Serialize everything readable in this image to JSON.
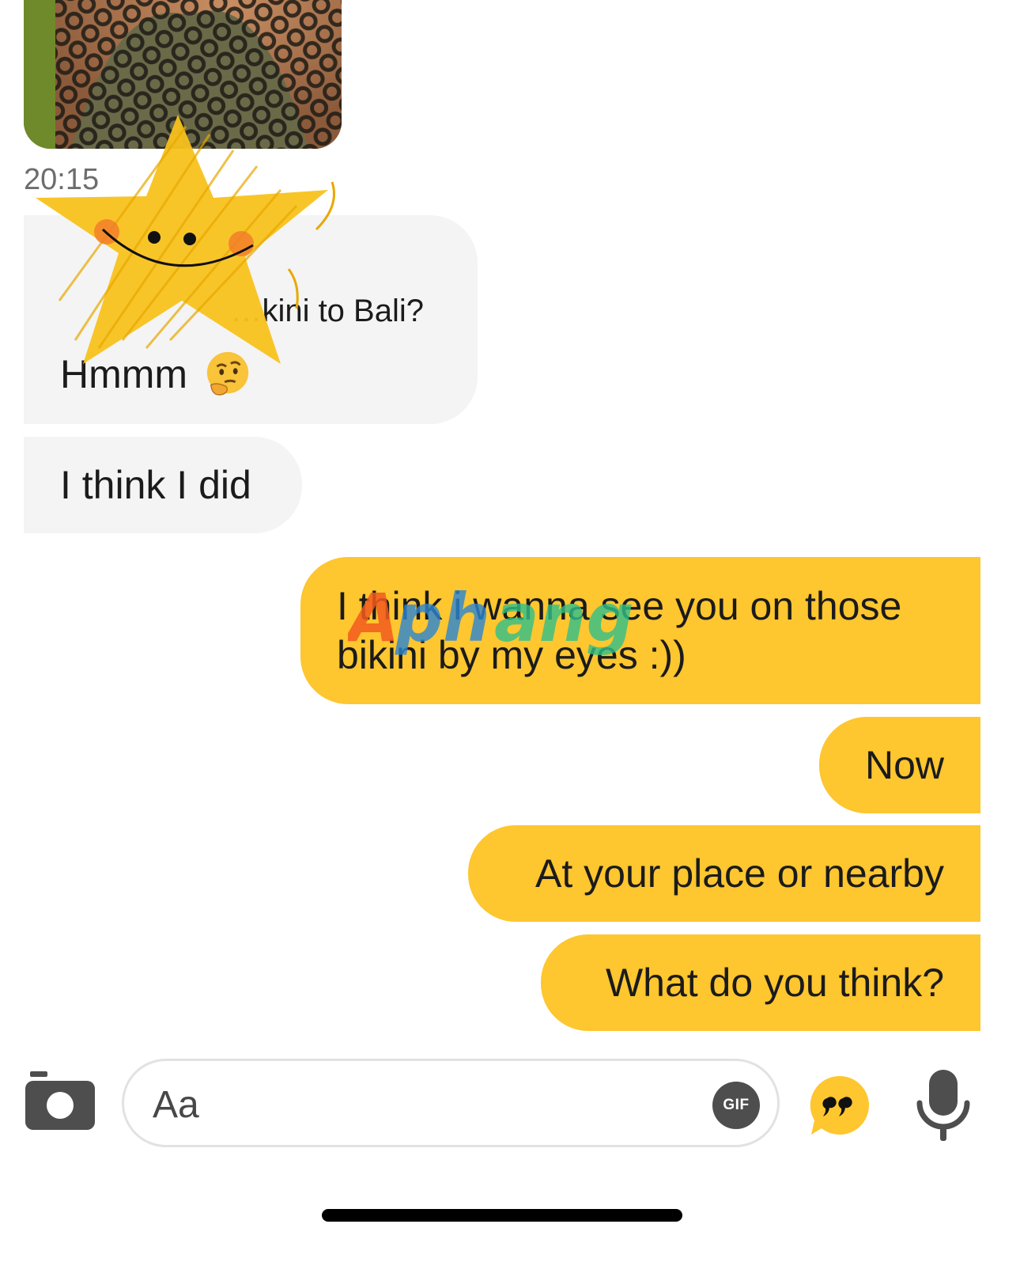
{
  "chat": {
    "timestamp": "20:15",
    "messages": [
      {
        "side": "incoming",
        "quote": "…kini to Bali?",
        "text": "Hmmm",
        "emoji": "thinking-face"
      },
      {
        "side": "incoming",
        "text": "I think I did"
      },
      {
        "side": "outgoing",
        "line1": "I think i wanna see you on those",
        "line2": "bikini by my eyes :))"
      },
      {
        "side": "outgoing",
        "text": "Now"
      },
      {
        "side": "outgoing",
        "text": "At your place or nearby"
      },
      {
        "side": "outgoing",
        "text": "What do you think?"
      }
    ],
    "overlays": {
      "sticker": "star-sticker",
      "watermark": "Aphang"
    }
  },
  "composer": {
    "placeholder": "Aa",
    "gif_label": "GIF",
    "icons": [
      "camera-icon",
      "quote-icon",
      "microphone-icon"
    ]
  },
  "colors": {
    "outgoing_bubble": "#fec62f",
    "incoming_bubble": "#f4f4f4",
    "icon_gray": "#4e4e4e"
  }
}
